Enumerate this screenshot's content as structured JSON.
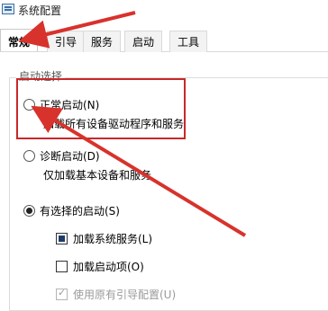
{
  "window": {
    "title": "系统配置"
  },
  "tabs": [
    {
      "label": "常规",
      "active": true
    },
    {
      "label": "引导",
      "active": false
    },
    {
      "label": "服务",
      "active": false
    },
    {
      "label": "启动",
      "active": false
    },
    {
      "label": "工具",
      "active": false
    }
  ],
  "startup": {
    "group_title": "启动选择",
    "normal": {
      "label": "正常启动(N)",
      "desc": "加载所有设备驱动程序和服务",
      "checked": false
    },
    "diagnostic": {
      "label": "诊断启动(D)",
      "desc": "仅加载基本设备和服务",
      "checked": false
    },
    "selective": {
      "label": "有选择的启动(S)",
      "checked": true
    },
    "options": [
      {
        "label": "加载系统服务(L)",
        "state": "indeterminate"
      },
      {
        "label": "加载启动项(O)",
        "state": "unchecked"
      },
      {
        "label": "使用原有引导配置(U)",
        "state": "checked-disabled"
      }
    ]
  },
  "annotation_color": "#c8282a"
}
